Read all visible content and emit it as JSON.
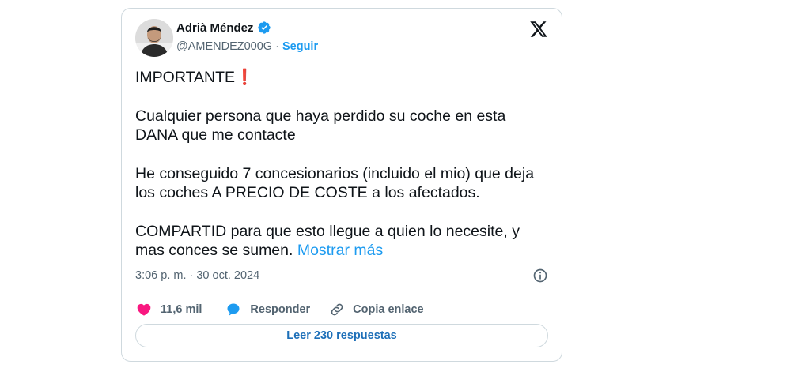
{
  "user": {
    "name": "Adrià Méndez",
    "handle": "@AMENDEZ000G",
    "separator": " · ",
    "follow_label": "Seguir"
  },
  "tweet": {
    "heading": "IMPORTANTE",
    "heading_emoji": "❗",
    "paragraph1_line1": "Cualquier persona que haya perdido su coche en esta",
    "paragraph1_line2": "DANA que me contacte",
    "paragraph2_line1": "He conseguido 7 concesionarios (incluido el mio) que deja",
    "paragraph2_line2": "los coches A PRECIO DE COSTE a los afectados.",
    "paragraph3_line1": "COMPARTID para que esto llegue a quien lo necesite, y",
    "paragraph3_line2": "mas conces se sumen.",
    "show_more_label": "Mostrar más",
    "timestamp": "3:06 p. m. · 30 oct. 2024"
  },
  "actions": {
    "like_count": "11,6 mil",
    "reply_label": "Responder",
    "copy_label": "Copia enlace",
    "read_replies_label": "Leer 230 respuestas"
  },
  "icons": {
    "verified": "verified-badge-icon",
    "x_logo": "x-logo-icon",
    "info": "info-icon",
    "like": "heart-icon",
    "reply": "speech-bubble-icon",
    "copy": "link-icon"
  },
  "colors": {
    "accent": "#1d9bf0",
    "like": "#f91880",
    "text": "#0f1419",
    "secondary": "#536471",
    "border": "#cfd9de"
  }
}
